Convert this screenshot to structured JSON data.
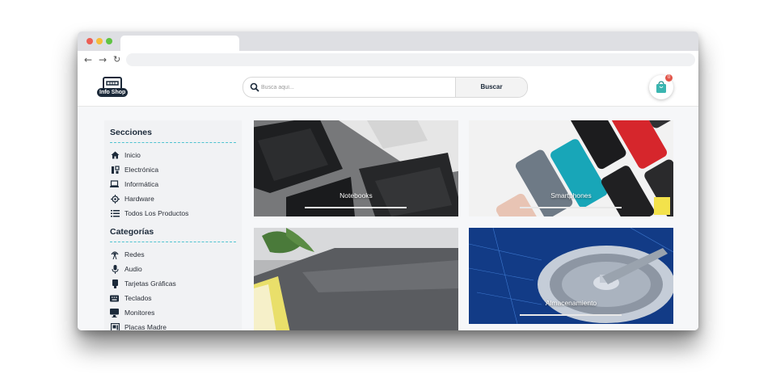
{
  "browser": {
    "controls": {
      "close_color": "#ec5f55",
      "minimize_color": "#f5bd3a",
      "maximize_color": "#5fc442"
    },
    "nav": {
      "back": "←",
      "forward": "→",
      "reload": "↻"
    }
  },
  "header": {
    "logo_text": "Info Shop",
    "search": {
      "placeholder": "Busca aquí...",
      "button_label": "Buscar"
    },
    "cart": {
      "badge_count": "0"
    }
  },
  "sidebar": {
    "sections": [
      {
        "title": "Secciones",
        "items": [
          {
            "label": "Inicio",
            "icon": "home-icon"
          },
          {
            "label": "Electrónica",
            "icon": "electronics-icon"
          },
          {
            "label": "Informática",
            "icon": "laptop-icon"
          },
          {
            "label": "Hardware",
            "icon": "chip-icon"
          },
          {
            "label": "Todos Los Productos",
            "icon": "list-icon"
          }
        ]
      },
      {
        "title": "Categorías",
        "items": [
          {
            "label": "Redes",
            "icon": "antenna-icon"
          },
          {
            "label": "Audio",
            "icon": "microphone-icon"
          },
          {
            "label": "Tarjetas Gráficas",
            "icon": "gpu-icon"
          },
          {
            "label": "Teclados",
            "icon": "keyboard-icon"
          },
          {
            "label": "Monitores",
            "icon": "monitor-icon"
          },
          {
            "label": "Placas Madre",
            "icon": "motherboard-icon"
          }
        ]
      }
    ]
  },
  "categories": [
    {
      "label": "Notebooks"
    },
    {
      "label": "Smartphones"
    },
    {
      "label": ""
    },
    {
      "label": "Almacenamiento"
    }
  ],
  "colors": {
    "accent": "#4fc3d0",
    "brand_dark": "#1c2a3a",
    "cart_bag": "#3ab5b0",
    "badge": "#e2554a"
  }
}
